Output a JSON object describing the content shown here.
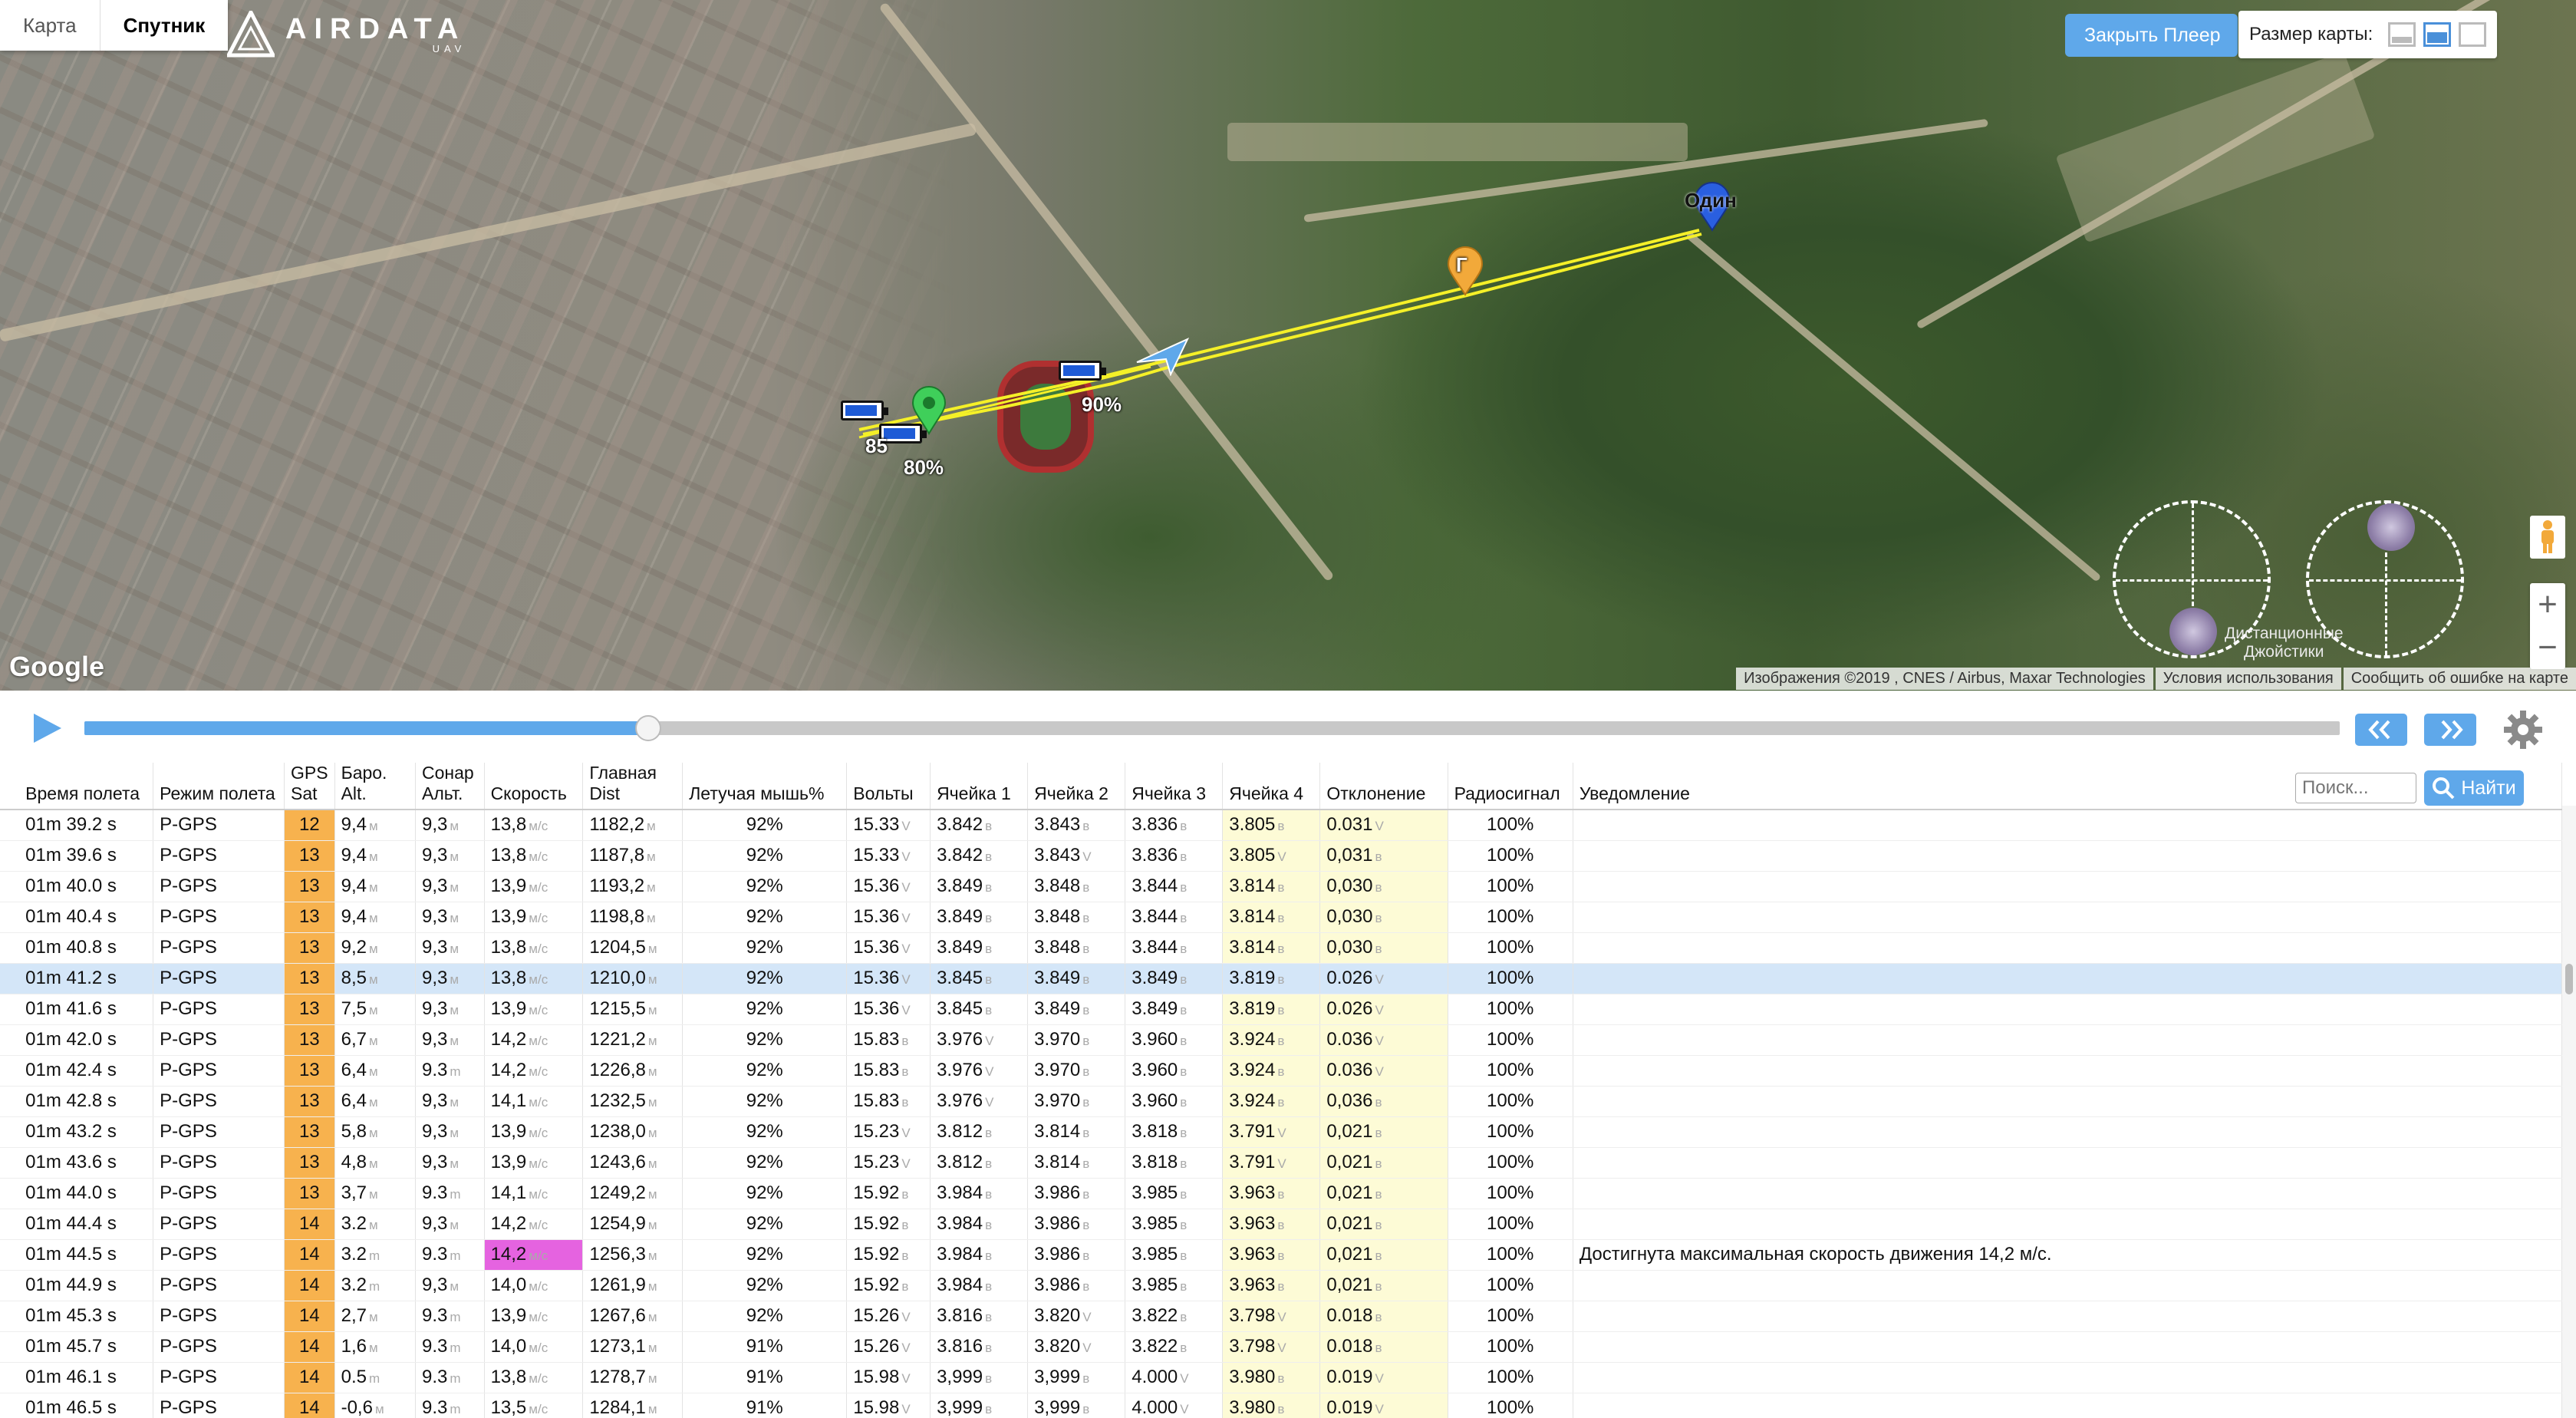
{
  "map": {
    "type_buttons": [
      "Карта",
      "Спутник"
    ],
    "logo": {
      "name": "AIRDATA",
      "sub": "UAV"
    },
    "close_player": "Закрыть Плеер",
    "map_size_label": "Размер карты:",
    "markers": {
      "home": "80%",
      "battery1": "85",
      "battery2": "90%",
      "orange_label": "Г",
      "blue_label": "Один"
    },
    "google": "Google",
    "attribution": [
      "Изображения ©2019 , CNES / Airbus, Maxar Technologies",
      "Условия использования",
      "Сообщить об ошибке на карте"
    ],
    "joystick_label_1": "Дистанционные",
    "joystick_label_2": "Джойстики",
    "zoom_in": "+",
    "zoom_out": "−",
    "colors": {
      "track": "#f5f028",
      "accent": "#5fa8ea"
    }
  },
  "player": {
    "progress": 0.25
  },
  "table": {
    "headers": [
      "Время полета",
      "Режим полета",
      "GPS Sat",
      "Баро. Alt.",
      "Сонар Альт.",
      "Скорость",
      "Главная Dist",
      "Летучая мышь%",
      "Вольты",
      "Ячейка 1",
      "Ячейка 2",
      "Ячейка 3",
      "Ячейка 4",
      "Отклонение",
      "Радиосигнал",
      "Уведомление"
    ],
    "search_placeholder": "Поиск...",
    "search_button": "Найти",
    "rows": [
      {
        "time": "01m 39.2 s",
        "mode": "P-GPS",
        "gps": "12",
        "baro": "9,4",
        "baro_u": "м",
        "sonar": "9,3",
        "sonar_u": "м",
        "speed": "13,8",
        "speed_u": "м/с",
        "dist": "1182,2",
        "dist_u": "м",
        "bat": "92%",
        "volt": "15.33",
        "volt_u": "V",
        "c1": "3.842",
        "c1_u": "в",
        "c2": "3.843",
        "c2_u": "в",
        "c3": "3.836",
        "c3_u": "в",
        "c4": "3.805",
        "c4_u": "в",
        "dev": "0.031",
        "dev_u": "V",
        "radio": "100%",
        "note": ""
      },
      {
        "time": "01m 39.6 s",
        "mode": "P-GPS",
        "gps": "13",
        "baro": "9,4",
        "baro_u": "м",
        "sonar": "9,3",
        "sonar_u": "м",
        "speed": "13,8",
        "speed_u": "м/с",
        "dist": "1187,8",
        "dist_u": "м",
        "bat": "92%",
        "volt": "15.33",
        "volt_u": "V",
        "c1": "3.842",
        "c1_u": "в",
        "c2": "3.843",
        "c2_u": "V",
        "c3": "3.836",
        "c3_u": "в",
        "c4": "3.805",
        "c4_u": "V",
        "dev": "0,031",
        "dev_u": "в",
        "radio": "100%",
        "note": ""
      },
      {
        "time": "01m 40.0 s",
        "mode": "P-GPS",
        "gps": "13",
        "baro": "9,4",
        "baro_u": "м",
        "sonar": "9,3",
        "sonar_u": "м",
        "speed": "13,9",
        "speed_u": "м/с",
        "dist": "1193,2",
        "dist_u": "м",
        "bat": "92%",
        "volt": "15.36",
        "volt_u": "V",
        "c1": "3.849",
        "c1_u": "в",
        "c2": "3.848",
        "c2_u": "в",
        "c3": "3.844",
        "c3_u": "в",
        "c4": "3.814",
        "c4_u": "в",
        "dev": "0,030",
        "dev_u": "в",
        "radio": "100%",
        "note": ""
      },
      {
        "time": "01m 40.4 s",
        "mode": "P-GPS",
        "gps": "13",
        "baro": "9,4",
        "baro_u": "м",
        "sonar": "9,3",
        "sonar_u": "м",
        "speed": "13,9",
        "speed_u": "м/с",
        "dist": "1198,8",
        "dist_u": "м",
        "bat": "92%",
        "volt": "15.36",
        "volt_u": "V",
        "c1": "3.849",
        "c1_u": "в",
        "c2": "3.848",
        "c2_u": "в",
        "c3": "3.844",
        "c3_u": "в",
        "c4": "3.814",
        "c4_u": "в",
        "dev": "0,030",
        "dev_u": "в",
        "radio": "100%",
        "note": ""
      },
      {
        "time": "01m 40.8 s",
        "mode": "P-GPS",
        "gps": "13",
        "baro": "9,2",
        "baro_u": "м",
        "sonar": "9,3",
        "sonar_u": "м",
        "speed": "13,8",
        "speed_u": "м/с",
        "dist": "1204,5",
        "dist_u": "м",
        "bat": "92%",
        "volt": "15.36",
        "volt_u": "V",
        "c1": "3.849",
        "c1_u": "в",
        "c2": "3.848",
        "c2_u": "в",
        "c3": "3.844",
        "c3_u": "в",
        "c4": "3.814",
        "c4_u": "в",
        "dev": "0,030",
        "dev_u": "в",
        "radio": "100%",
        "note": ""
      },
      {
        "time": "01m 41.2 s",
        "mode": "P-GPS",
        "gps": "13",
        "baro": "8,5",
        "baro_u": "м",
        "sonar": "9,3",
        "sonar_u": "м",
        "speed": "13,8",
        "speed_u": "м/с",
        "dist": "1210,0",
        "dist_u": "м",
        "bat": "92%",
        "volt": "15.36",
        "volt_u": "V",
        "c1": "3.845",
        "c1_u": "в",
        "c2": "3.849",
        "c2_u": "в",
        "c3": "3.849",
        "c3_u": "в",
        "c4": "3.819",
        "c4_u": "в",
        "dev": "0.026",
        "dev_u": "V",
        "radio": "100%",
        "note": "",
        "sel": true
      },
      {
        "time": "01m 41.6 s",
        "mode": "P-GPS",
        "gps": "13",
        "baro": "7,5",
        "baro_u": "м",
        "sonar": "9,3",
        "sonar_u": "м",
        "speed": "13,9",
        "speed_u": "м/с",
        "dist": "1215,5",
        "dist_u": "м",
        "bat": "92%",
        "volt": "15.36",
        "volt_u": "V",
        "c1": "3.845",
        "c1_u": "в",
        "c2": "3.849",
        "c2_u": "в",
        "c3": "3.849",
        "c3_u": "в",
        "c4": "3.819",
        "c4_u": "в",
        "dev": "0.026",
        "dev_u": "V",
        "radio": "100%",
        "note": ""
      },
      {
        "time": "01m 42.0 s",
        "mode": "P-GPS",
        "gps": "13",
        "baro": "6,7",
        "baro_u": "м",
        "sonar": "9,3",
        "sonar_u": "м",
        "speed": "14,2",
        "speed_u": "м/с",
        "dist": "1221,2",
        "dist_u": "м",
        "bat": "92%",
        "volt": "15.83",
        "volt_u": "в",
        "c1": "3.976",
        "c1_u": "V",
        "c2": "3.970",
        "c2_u": "в",
        "c3": "3.960",
        "c3_u": "в",
        "c4": "3.924",
        "c4_u": "в",
        "dev": "0.036",
        "dev_u": "V",
        "radio": "100%",
        "note": ""
      },
      {
        "time": "01m 42.4 s",
        "mode": "P-GPS",
        "gps": "13",
        "baro": "6,4",
        "baro_u": "м",
        "sonar": "9.3",
        "sonar_u": "m",
        "speed": "14,2",
        "speed_u": "м/с",
        "dist": "1226,8",
        "dist_u": "м",
        "bat": "92%",
        "volt": "15.83",
        "volt_u": "в",
        "c1": "3.976",
        "c1_u": "V",
        "c2": "3.970",
        "c2_u": "в",
        "c3": "3.960",
        "c3_u": "в",
        "c4": "3.924",
        "c4_u": "в",
        "dev": "0.036",
        "dev_u": "V",
        "radio": "100%",
        "note": ""
      },
      {
        "time": "01m 42.8 s",
        "mode": "P-GPS",
        "gps": "13",
        "baro": "6,4",
        "baro_u": "м",
        "sonar": "9,3",
        "sonar_u": "м",
        "speed": "14,1",
        "speed_u": "м/с",
        "dist": "1232,5",
        "dist_u": "м",
        "bat": "92%",
        "volt": "15.83",
        "volt_u": "в",
        "c1": "3.976",
        "c1_u": "V",
        "c2": "3.970",
        "c2_u": "в",
        "c3": "3.960",
        "c3_u": "в",
        "c4": "3.924",
        "c4_u": "в",
        "dev": "0,036",
        "dev_u": "в",
        "radio": "100%",
        "note": ""
      },
      {
        "time": "01m 43.2 s",
        "mode": "P-GPS",
        "gps": "13",
        "baro": "5,8",
        "baro_u": "м",
        "sonar": "9,3",
        "sonar_u": "м",
        "speed": "13,9",
        "speed_u": "м/с",
        "dist": "1238,0",
        "dist_u": "м",
        "bat": "92%",
        "volt": "15.23",
        "volt_u": "V",
        "c1": "3.812",
        "c1_u": "в",
        "c2": "3.814",
        "c2_u": "в",
        "c3": "3.818",
        "c3_u": "в",
        "c4": "3.791",
        "c4_u": "V",
        "dev": "0,021",
        "dev_u": "в",
        "radio": "100%",
        "note": ""
      },
      {
        "time": "01m 43.6 s",
        "mode": "P-GPS",
        "gps": "13",
        "baro": "4,8",
        "baro_u": "м",
        "sonar": "9,3",
        "sonar_u": "м",
        "speed": "13,9",
        "speed_u": "м/с",
        "dist": "1243,6",
        "dist_u": "м",
        "bat": "92%",
        "volt": "15.23",
        "volt_u": "V",
        "c1": "3.812",
        "c1_u": "в",
        "c2": "3.814",
        "c2_u": "в",
        "c3": "3.818",
        "c3_u": "в",
        "c4": "3.791",
        "c4_u": "V",
        "dev": "0,021",
        "dev_u": "в",
        "radio": "100%",
        "note": ""
      },
      {
        "time": "01m 44.0 s",
        "mode": "P-GPS",
        "gps": "13",
        "baro": "3,7",
        "baro_u": "м",
        "sonar": "9.3",
        "sonar_u": "m",
        "speed": "14,1",
        "speed_u": "м/с",
        "dist": "1249,2",
        "dist_u": "м",
        "bat": "92%",
        "volt": "15.92",
        "volt_u": "в",
        "c1": "3.984",
        "c1_u": "в",
        "c2": "3.986",
        "c2_u": "в",
        "c3": "3.985",
        "c3_u": "в",
        "c4": "3.963",
        "c4_u": "в",
        "dev": "0,021",
        "dev_u": "в",
        "radio": "100%",
        "note": ""
      },
      {
        "time": "01m 44.4 s",
        "mode": "P-GPS",
        "gps": "14",
        "baro": "3.2",
        "baro_u": "м",
        "sonar": "9,3",
        "sonar_u": "м",
        "speed": "14,2",
        "speed_u": "м/с",
        "dist": "1254,9",
        "dist_u": "м",
        "bat": "92%",
        "volt": "15.92",
        "volt_u": "в",
        "c1": "3.984",
        "c1_u": "в",
        "c2": "3.986",
        "c2_u": "в",
        "c3": "3.985",
        "c3_u": "в",
        "c4": "3.963",
        "c4_u": "в",
        "dev": "0,021",
        "dev_u": "в",
        "radio": "100%",
        "note": ""
      },
      {
        "time": "01m 44.5 s",
        "mode": "P-GPS",
        "gps": "14",
        "baro": "3.2",
        "baro_u": "m",
        "sonar": "9.3",
        "sonar_u": "m",
        "speed": "14,2",
        "speed_u": "м/с",
        "dist": "1256,3",
        "dist_u": "м",
        "bat": "92%",
        "volt": "15.92",
        "volt_u": "в",
        "c1": "3.984",
        "c1_u": "в",
        "c2": "3.986",
        "c2_u": "в",
        "c3": "3.985",
        "c3_u": "в",
        "c4": "3.963",
        "c4_u": "в",
        "dev": "0,021",
        "dev_u": "в",
        "radio": "100%",
        "note": "Достигнута максимальная скорость движения 14,2 м/с.",
        "alert": true
      },
      {
        "time": "01m 44.9 s",
        "mode": "P-GPS",
        "gps": "14",
        "baro": "3.2",
        "baro_u": "m",
        "sonar": "9,3",
        "sonar_u": "м",
        "speed": "14,0",
        "speed_u": "м/с",
        "dist": "1261,9",
        "dist_u": "м",
        "bat": "92%",
        "volt": "15.92",
        "volt_u": "в",
        "c1": "3.984",
        "c1_u": "в",
        "c2": "3.986",
        "c2_u": "в",
        "c3": "3.985",
        "c3_u": "в",
        "c4": "3.963",
        "c4_u": "в",
        "dev": "0,021",
        "dev_u": "в",
        "radio": "100%",
        "note": ""
      },
      {
        "time": "01m 45.3 s",
        "mode": "P-GPS",
        "gps": "14",
        "baro": "2,7",
        "baro_u": "м",
        "sonar": "9.3",
        "sonar_u": "m",
        "speed": "13,9",
        "speed_u": "м/с",
        "dist": "1267,6",
        "dist_u": "м",
        "bat": "92%",
        "volt": "15.26",
        "volt_u": "V",
        "c1": "3.816",
        "c1_u": "в",
        "c2": "3.820",
        "c2_u": "V",
        "c3": "3.822",
        "c3_u": "в",
        "c4": "3.798",
        "c4_u": "V",
        "dev": "0.018",
        "dev_u": "в",
        "radio": "100%",
        "note": ""
      },
      {
        "time": "01m 45.7 s",
        "mode": "P-GPS",
        "gps": "14",
        "baro": "1,6",
        "baro_u": "м",
        "sonar": "9.3",
        "sonar_u": "m",
        "speed": "14,0",
        "speed_u": "м/с",
        "dist": "1273,1",
        "dist_u": "м",
        "bat": "91%",
        "volt": "15.26",
        "volt_u": "V",
        "c1": "3.816",
        "c1_u": "в",
        "c2": "3.820",
        "c2_u": "V",
        "c3": "3.822",
        "c3_u": "в",
        "c4": "3.798",
        "c4_u": "V",
        "dev": "0.018",
        "dev_u": "в",
        "radio": "100%",
        "note": ""
      },
      {
        "time": "01m 46.1 s",
        "mode": "P-GPS",
        "gps": "14",
        "baro": "0.5",
        "baro_u": "m",
        "sonar": "9.3",
        "sonar_u": "m",
        "speed": "13,8",
        "speed_u": "м/с",
        "dist": "1278,7",
        "dist_u": "м",
        "bat": "91%",
        "volt": "15.98",
        "volt_u": "V",
        "c1": "3,999",
        "c1_u": "в",
        "c2": "3,999",
        "c2_u": "в",
        "c3": "4.000",
        "c3_u": "V",
        "c4": "3.980",
        "c4_u": "в",
        "dev": "0.019",
        "dev_u": "V",
        "radio": "100%",
        "note": ""
      },
      {
        "time": "01m 46.5 s",
        "mode": "P-GPS",
        "gps": "14",
        "baro": "-0,6",
        "baro_u": "м",
        "sonar": "9.3",
        "sonar_u": "m",
        "speed": "13,5",
        "speed_u": "м/с",
        "dist": "1284,1",
        "dist_u": "м",
        "bat": "91%",
        "volt": "15.98",
        "volt_u": "V",
        "c1": "3,999",
        "c1_u": "в",
        "c2": "3,999",
        "c2_u": "в",
        "c3": "4.000",
        "c3_u": "V",
        "c4": "3.980",
        "c4_u": "в",
        "dev": "0.019",
        "dev_u": "V",
        "radio": "100%",
        "note": ""
      }
    ]
  }
}
